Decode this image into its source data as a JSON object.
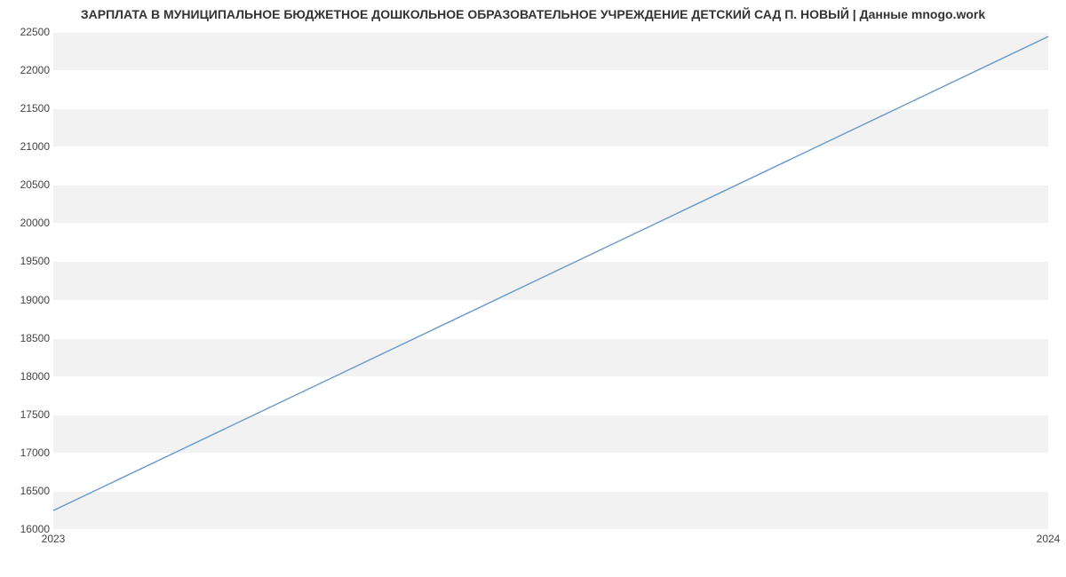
{
  "chart_data": {
    "type": "line",
    "title": "ЗАРПЛАТА В МУНИЦИПАЛЬНОЕ БЮДЖЕТНОЕ ДОШКОЛЬНОЕ ОБРАЗОВАТЕЛЬНОЕ УЧРЕЖДЕНИЕ ДЕТСКИЙ САД П. НОВЫЙ | Данные mnogo.work",
    "x": [
      2023,
      2024
    ],
    "values": [
      16242,
      22440
    ],
    "xlabel": "",
    "ylabel": "",
    "xlim": [
      2023,
      2024
    ],
    "ylim": [
      16000,
      22500
    ],
    "x_ticks": [
      2023,
      2024
    ],
    "y_ticks": [
      16000,
      16500,
      17000,
      17500,
      18000,
      18500,
      19000,
      19500,
      20000,
      20500,
      21000,
      21500,
      22000,
      22500
    ],
    "legend": null,
    "line_color": "#6699cc",
    "grid": true
  }
}
